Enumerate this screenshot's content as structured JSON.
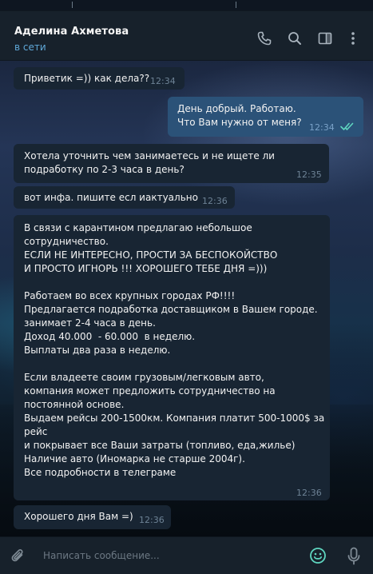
{
  "contact": {
    "name": "Аделина Ахметова",
    "status": "в сети"
  },
  "header_icons": [
    "phone-icon",
    "search-icon",
    "sidebar-toggle-icon",
    "more-vertical-icon"
  ],
  "messages": [
    {
      "direction": "in",
      "text": "Приветик =)) как дела??",
      "time": "12:34"
    },
    {
      "direction": "out",
      "text": "День добрый. Работаю.\nЧто Вам нужно от меня?",
      "time": "12:34",
      "read": true
    },
    {
      "direction": "in",
      "text": "Хотела уточнить чем занимаетесь и не ищете ли\nподработку по 2-3 часа в день?",
      "time": "12:35"
    },
    {
      "direction": "in",
      "text": "вот инфа. пишите есл иактуально",
      "time": "12:36"
    },
    {
      "direction": "in",
      "text": "В связи с карантином предлагаю небольшое\nсотрудничество.\nЕСЛИ НЕ ИНТЕРЕСНО, ПРОСТИ ЗА БЕСПОКОЙСТВО\nИ ПРОСТО ИГНОРЬ !!! ХОРОШЕГО ТЕБЕ ДНЯ =)))\n\nРаботаем во всех крупных городах РФ!!!!\nПредлагается подработка доставщиком в Вашем городе.\nзанимает 2-4 часа в день.\nДоход 40.000  - 60.000  в неделю.\nВыплаты два раза в неделю.\n\nЕсли владеете своим грузовым/легковым авто,\nкомпания может предложить сотрудничество на\nпостоянной основе.\nВыдаем рейсы 200-1500км. Компания платит 500-1000$ за\nрейс\nи покрывает все Ваши затраты (топливо, еда,жилье)\nНаличие авто (Иномарка не старше 2004г).\nВсе подробности в телеграме",
      "time": "12:36"
    },
    {
      "direction": "in",
      "text": "Хорошего дня Вам =)",
      "time": "12:36"
    }
  ],
  "composer": {
    "placeholder": "Написать сообщение..."
  },
  "colors": {
    "panel": "#17212b",
    "incoming_bubble": "#182533",
    "outgoing_bubble": "#2b5278",
    "accent": "#5fa8d8",
    "read_ticks": "#5fd6c0"
  }
}
